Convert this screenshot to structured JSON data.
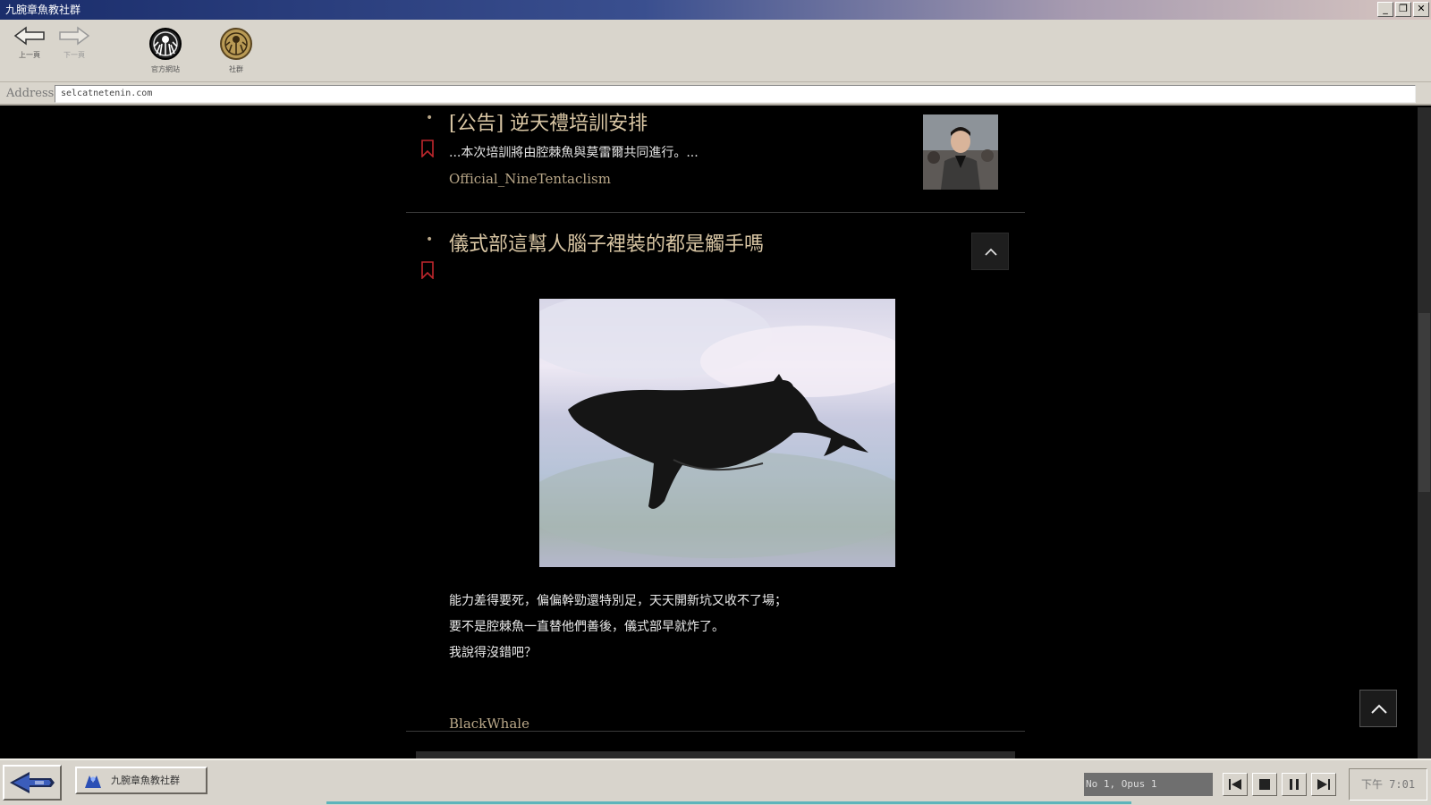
{
  "window": {
    "title": "九腕章魚教社群",
    "minimize": "_",
    "maximize": "❐",
    "close": "✕"
  },
  "toolbar": {
    "back_label": "上一頁",
    "forward_label": "下一頁",
    "official_label": "官方網站",
    "community_label": "社群"
  },
  "address": {
    "label": "Address",
    "value": "selcatnetenin.com"
  },
  "posts": [
    {
      "title": "[公告] 逆天禮培訓安排",
      "excerpt": "...本次培訓將由腔棘魚與莫雷爾共同進行。...",
      "author": "Official_NineTentaclism"
    },
    {
      "title": "儀式部這幫人腦子裡裝的都是觸手嗎",
      "body": [
        "能力差得要死，偏偏幹勁還特別足，天天開新坑又收不了場；",
        "要不是腔棘魚一直替他們善後，儀式部早就炸了。",
        "我說得沒錯吧？"
      ],
      "author": "BlackWhale"
    }
  ],
  "taskbar": {
    "task_label": "九腕章魚教社群",
    "now_playing": "No 1, Opus 1",
    "clock": "下午 7:01"
  },
  "colors": {
    "accent_text": "#d9c6a4",
    "bookmark": "#c0272d",
    "titlebar": "#1a2d6b"
  }
}
